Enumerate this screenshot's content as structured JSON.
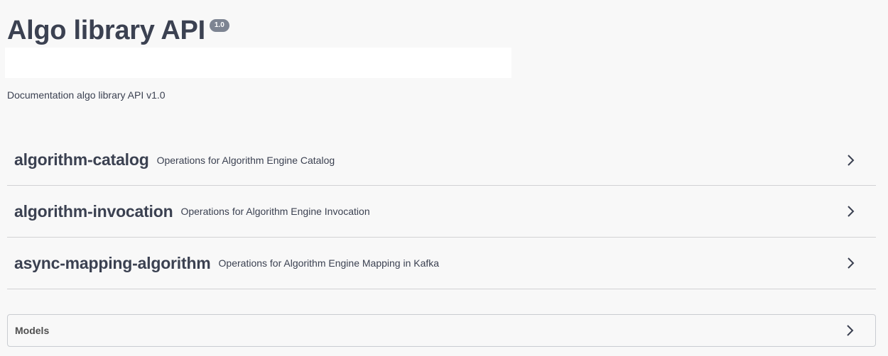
{
  "info": {
    "title": "Algo library API",
    "version": "1.0",
    "description": "Documentation algo library API v1.0"
  },
  "tags": [
    {
      "name": "algorithm-catalog",
      "description": "Operations for Algorithm Engine Catalog"
    },
    {
      "name": "algorithm-invocation",
      "description": "Operations for Algorithm Engine Invocation"
    },
    {
      "name": "async-mapping-algorithm",
      "description": "Operations for Algorithm Engine Mapping in Kafka"
    }
  ],
  "models": {
    "label": "Models"
  },
  "icons": {
    "expand": "chevron-right-icon"
  },
  "colors": {
    "text": "#3b4151",
    "badge": "#7d8492",
    "divider": "#d2d2d4",
    "background": "#f8f8f8"
  }
}
